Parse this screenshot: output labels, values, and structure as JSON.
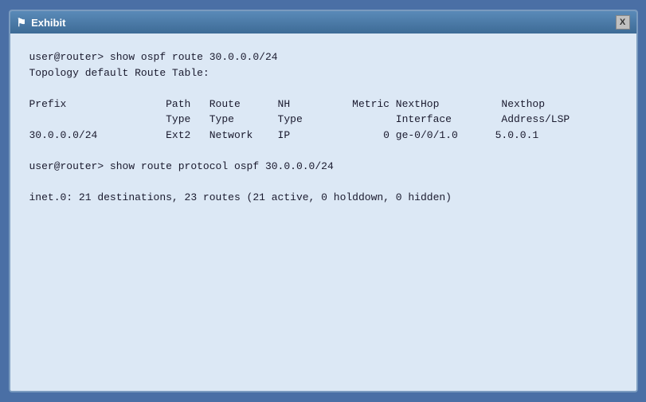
{
  "window": {
    "title": "Exhibit",
    "close_label": "X"
  },
  "terminal": {
    "lines": [
      "user@router> show ospf route 30.0.0.0/24",
      "Topology default Route Table:",
      "",
      "Prefix                Path   Route      NH          Metric NextHop          Nexthop",
      "                      Type   Type       Type               Interface        Address/LSP",
      "30.0.0.0/24           Ext2   Network    IP               0 ge-0/0/1.0      5.0.0.1",
      "",
      "user@router> show route protocol ospf 30.0.0.0/24",
      "",
      "inet.0: 21 destinations, 23 routes (21 active, 0 holddown, 0 hidden)"
    ]
  }
}
